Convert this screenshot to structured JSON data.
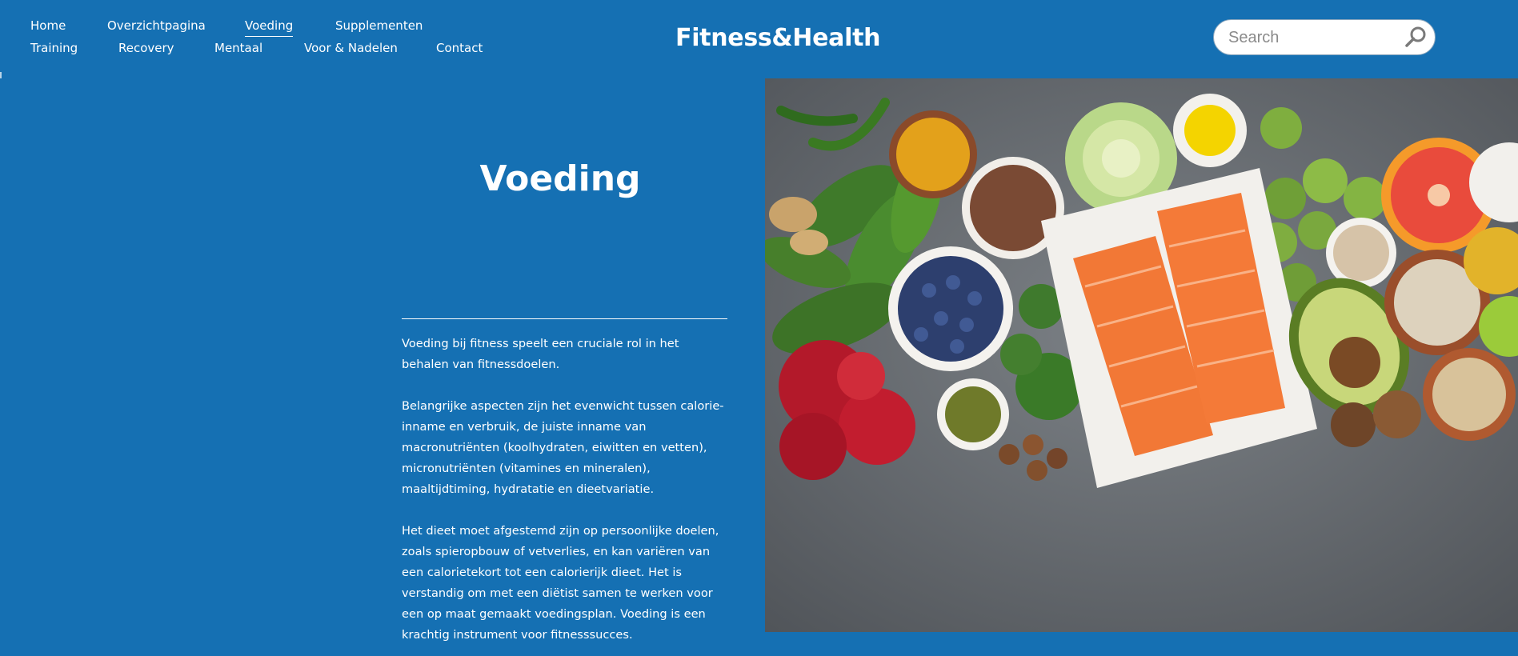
{
  "nav": {
    "row1": [
      "Home",
      "Overzichtpagina",
      "Voeding",
      "Supplementen"
    ],
    "row2": [
      "Training",
      "Recovery",
      "Mentaal",
      "Voor & Nadelen",
      "Contact"
    ],
    "active": "Voeding"
  },
  "brand": "Fitness&Health",
  "search": {
    "placeholder": "Search",
    "icon": "search-icon"
  },
  "main": {
    "title": "Voeding",
    "paragraphs": [
      "Voeding bij fitness speelt een cruciale rol in het behalen van fitnessdoelen.",
      "Belangrijke aspecten zijn het evenwicht tussen calorie-inname en verbruik, de juiste inname van macronutriënten (koolhydraten, eiwitten en vetten), micronutriënten (vitamines en mineralen), maaltijdtiming, hydratatie en dieetvariatie.",
      "Het dieet moet afgestemd zijn op persoonlijke doelen, zoals spieropbouw of vetverlies, en kan variëren van een calorietekort tot een calorierijk dieet. Het is verstandig om met een diëtist samen te werken voor een op maat gemaakt voedingsplan. Voeding is een krachtig instrument voor fitnesssucces."
    ]
  },
  "colors": {
    "background": "#1570b3",
    "text": "#ffffff",
    "salmon": "#f07a3c",
    "concrete": "#6f7479"
  }
}
